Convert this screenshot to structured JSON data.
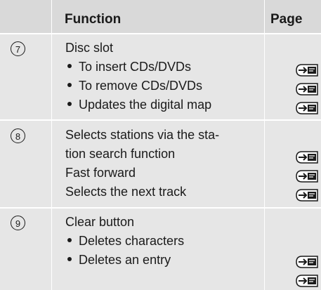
{
  "header": {
    "function_label": "Function",
    "page_label": "Page"
  },
  "rows": [
    {
      "number": "7",
      "lines": [
        "Disc slot",
        "To insert CDs/DVDs",
        "To remove CDs/DVDs",
        "Updates the digital map"
      ]
    },
    {
      "number": "8",
      "lines": [
        "Selects stations via the sta-",
        "tion search function",
        "Fast forward",
        "Selects the next track"
      ]
    },
    {
      "number": "9",
      "lines": [
        "Clear button",
        "Deletes characters",
        "Deletes an entry"
      ]
    }
  ],
  "icons": {
    "page_ref": "book-page-reference-icon"
  },
  "colors": {
    "header_bg": "#d9d9d9",
    "row_bg": "#e6e6e6",
    "text": "#1a1a1a"
  }
}
